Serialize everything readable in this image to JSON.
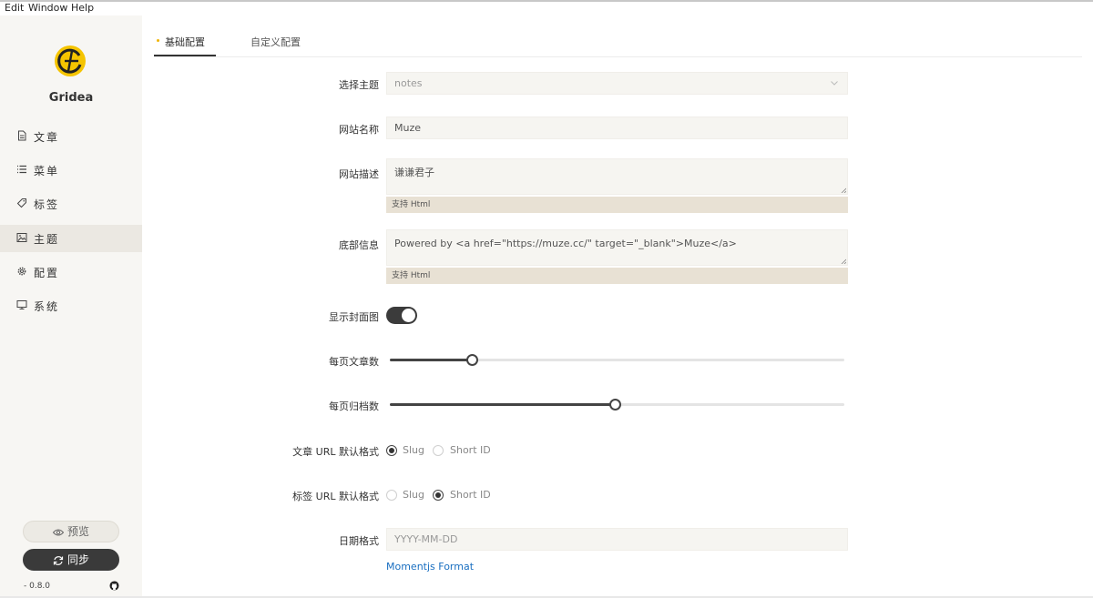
{
  "menu": [
    "Edit",
    "Window",
    "Help"
  ],
  "app": {
    "name": "Gridea",
    "version": "- 0.8.0",
    "accent": "#f5c400"
  },
  "sidebar": {
    "items": [
      {
        "label": "文章",
        "icon": "article-icon"
      },
      {
        "label": "菜单",
        "icon": "menu-list-icon"
      },
      {
        "label": "标签",
        "icon": "tag-icon"
      },
      {
        "label": "主题",
        "icon": "image-icon",
        "active": true
      },
      {
        "label": "配置",
        "icon": "gear-icon"
      },
      {
        "label": "系统",
        "icon": "monitor-icon"
      }
    ],
    "preview_label": "预览",
    "sync_label": "同步"
  },
  "tabs": [
    "基础配置",
    "自定义配置"
  ],
  "form": {
    "theme": {
      "label": "选择主题",
      "value": "notes"
    },
    "site_name": {
      "label": "网站名称",
      "value": "Muze"
    },
    "site_desc": {
      "label": "网站描述",
      "value": "谦谦君子",
      "hint": "支持 Html"
    },
    "footer": {
      "label": "底部信息",
      "value": "Powered by <a href=\"https://muze.cc/\" target=\"_blank\">Muze</a>",
      "hint": "支持 Html"
    },
    "show_cover": {
      "label": "显示封面图",
      "on": true
    },
    "posts_per_page": {
      "label": "每页文章数",
      "fraction": 0.18
    },
    "archives_per_page": {
      "label": "每页归档数",
      "fraction": 0.495
    },
    "post_url": {
      "label": "文章 URL 默认格式",
      "options": [
        "Slug",
        "Short ID"
      ],
      "selected": "Slug"
    },
    "tag_url": {
      "label": "标签 URL 默认格式",
      "options": [
        "Slug",
        "Short ID"
      ],
      "selected": "Short ID"
    },
    "date_format": {
      "label": "日期格式",
      "placeholder": "YYYY-MM-DD",
      "link": "Momentjs Format"
    }
  }
}
